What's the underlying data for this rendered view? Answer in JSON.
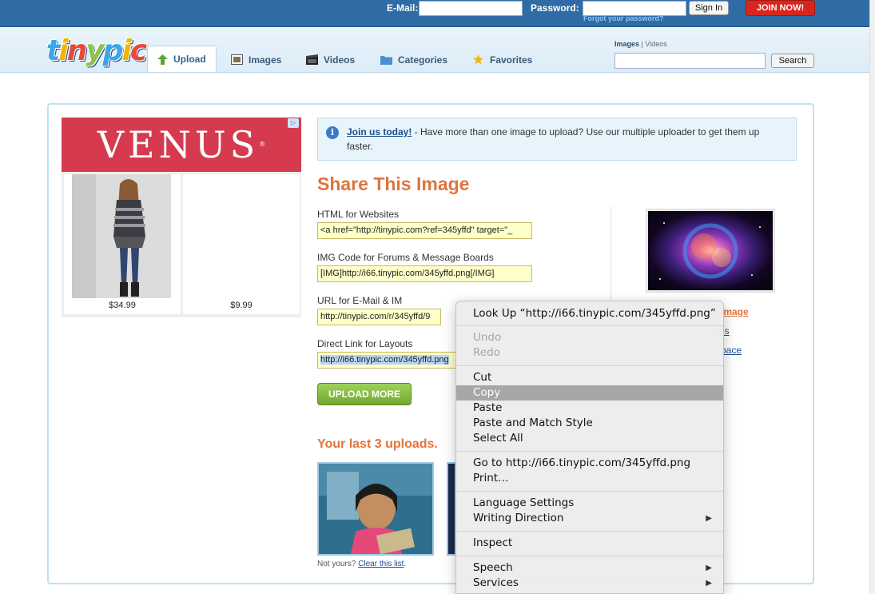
{
  "topbar": {
    "email_label": "E-Mail:",
    "password_label": "Password:",
    "signin_label": "Sign In",
    "forgot_label": "Forgot your password?",
    "join_label": "JOIN NOW!"
  },
  "header": {
    "logo_text": "tinypic",
    "tabs": [
      {
        "label": "Upload",
        "icon": "upload-arrow-icon"
      },
      {
        "label": "Images",
        "icon": "images-icon"
      },
      {
        "label": "Videos",
        "icon": "film-icon"
      },
      {
        "label": "Categories",
        "icon": "folder-icon"
      },
      {
        "label": "Favorites",
        "icon": "star-icon"
      }
    ],
    "search_toggle_images": "Images",
    "search_toggle_sep": " | ",
    "search_toggle_videos": "Videos",
    "search_label": "Search"
  },
  "ad": {
    "brand": "VENUS",
    "brand_mark": "®",
    "badge": "▷",
    "products": [
      {
        "price": "$34.99"
      },
      {
        "price": "$9.99"
      }
    ]
  },
  "notice": {
    "link": "Join us today!",
    "text": " - Have more than one image to upload? Use our multiple uploader to get them up faster."
  },
  "share": {
    "title": "Share This Image",
    "fields": [
      {
        "label": "HTML for Websites",
        "value": "<a href=\"http://tinypic.com?ref=345yffd\" target=\"_"
      },
      {
        "label": "IMG Code for Forums & Message Boards",
        "value": "[IMG]http://i66.tinypic.com/345yffd.png[/IMG]"
      },
      {
        "label": "URL for E-Mail & IM",
        "value": "http://tinypic.com/r/345yffd/9"
      },
      {
        "label": "Direct Link for Layouts",
        "value": "http://i66.tinypic.com/345yffd.png"
      }
    ],
    "side_links": [
      "e Image",
      "es",
      "pace"
    ],
    "upload_more": "UPLOAD MORE",
    "last_title": "Your last 3 uploads.",
    "not_yours": "Not yours? ",
    "clear_link": "Clear this list",
    "clear_end": "."
  },
  "context_menu": {
    "items": [
      {
        "label": "Look Up “http://i66.tinypic.com/345yffd.png”",
        "state": "normal"
      },
      {
        "label": "Undo",
        "state": "disabled"
      },
      {
        "label": "Redo",
        "state": "disabled"
      },
      {
        "label": "Cut",
        "state": "normal"
      },
      {
        "label": "Copy",
        "state": "highlighted"
      },
      {
        "label": "Paste",
        "state": "normal"
      },
      {
        "label": "Paste and Match Style",
        "state": "normal"
      },
      {
        "label": "Select All",
        "state": "normal"
      },
      {
        "label": "Go to http://i66.tinypic.com/345yffd.png",
        "state": "normal"
      },
      {
        "label": "Print…",
        "state": "normal"
      },
      {
        "label": "Language Settings",
        "state": "normal"
      },
      {
        "label": "Writing Direction",
        "state": "normal",
        "submenu": true
      },
      {
        "label": "Inspect",
        "state": "normal"
      },
      {
        "label": "Speech",
        "state": "normal",
        "submenu": true
      },
      {
        "label": "Services",
        "state": "normal",
        "submenu": true
      }
    ],
    "submenu_arrow": "▶"
  }
}
